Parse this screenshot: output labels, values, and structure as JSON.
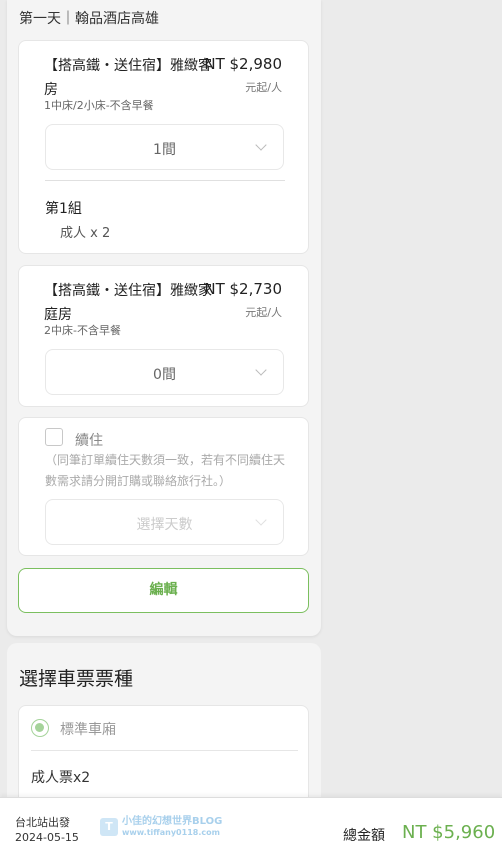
{
  "day_header": "第一天｜翰品酒店高雄",
  "rooms": [
    {
      "name": "【搭高鐵・送住宿】雅緻客房",
      "price": "NT $2,980",
      "unit": "元起/人",
      "sub": "1中床/2小床-不含早餐",
      "qty": "1間",
      "group_title": "第1組",
      "group_detail": "成人 x 2"
    },
    {
      "name": "【搭高鐵・送住宿】雅緻家庭房",
      "price": "NT $2,730",
      "unit": "元起/人",
      "sub": "2中床-不含早餐",
      "qty": "0間"
    }
  ],
  "continue_stay": {
    "label": "續住",
    "note": "（同筆訂單續住天數須一致，若有不同續住天數需求請分開訂購或聯絡旅行社。）",
    "placeholder": "選擇天數"
  },
  "edit_button": "編輯",
  "ticket": {
    "title": "選擇車票票種",
    "option": "標準車廂",
    "count": "成人票x2"
  },
  "footer": {
    "depart": "台北站出發",
    "date": "2024-05-15",
    "watermark_line1": "小佳的幻想世界BLOG",
    "watermark_line2": "www.tiffany0118.com",
    "total_label": "總金額",
    "total_value": "NT $5,960"
  },
  "colors": {
    "accent": "#6bb04f",
    "radio": "#a5d39a"
  }
}
